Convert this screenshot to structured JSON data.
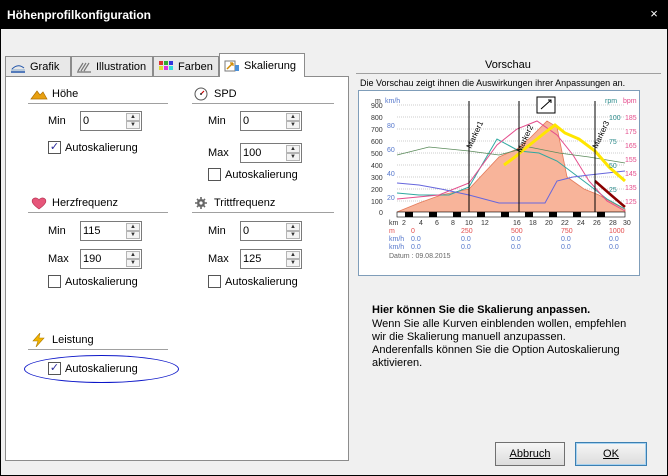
{
  "window": {
    "title": "Höhenprofilkonfiguration",
    "close_glyph": "×"
  },
  "tabs": [
    {
      "label": "Grafik",
      "icon": "grafik-icon"
    },
    {
      "label": "Illustration",
      "icon": "illustration-icon"
    },
    {
      "label": "Farben",
      "icon": "farben-icon"
    },
    {
      "label": "Skalierung",
      "icon": "skalierung-icon",
      "active": true
    }
  ],
  "groups": {
    "hoehe": {
      "title": "Höhe",
      "min_label": "Min",
      "min_value": "0",
      "autoscale_label": "Autoskalierung",
      "autoscale_checked": true
    },
    "spd": {
      "title": "SPD",
      "min_label": "Min",
      "min_value": "0",
      "max_label": "Max",
      "max_value": "100",
      "autoscale_label": "Autoskalierung",
      "autoscale_checked": false
    },
    "herzfrequenz": {
      "title": "Herzfrequenz",
      "min_label": "Min",
      "min_value": "115",
      "max_label": "Max",
      "max_value": "190",
      "autoscale_label": "Autoskalierung",
      "autoscale_checked": false
    },
    "trittfrequenz": {
      "title": "Trittfrequenz",
      "min_label": "Min",
      "min_value": "0",
      "max_label": "Max",
      "max_value": "125",
      "autoscale_label": "Autoskalierung",
      "autoscale_checked": false
    },
    "leistung": {
      "title": "Leistung",
      "autoscale_label": "Autoskalierung",
      "autoscale_checked": true
    }
  },
  "check_glyph": "✓",
  "preview": {
    "title": "Vorschau",
    "description": "Die Vorschau zeigt ihnen die Auswirkungen ihrer Anpassungen an.",
    "chart": {
      "left_units": [
        "m",
        "km/h"
      ],
      "right_units": [
        "rpm",
        "bpm"
      ],
      "y_left": [
        "900",
        "800",
        "700",
        "600",
        "500",
        "400",
        "300",
        "200",
        "100",
        "0"
      ],
      "y_spd": [
        "80",
        "60",
        "40",
        "20"
      ],
      "y_rpm": [
        "100",
        "75",
        "50",
        "25"
      ],
      "y_bpm": [
        "185",
        "175",
        "165",
        "155",
        "145",
        "135",
        "125"
      ],
      "markers": [
        "Marker1",
        "Marker2",
        "Marker3"
      ],
      "km_label": "km",
      "km_ticks": [
        "2",
        "4",
        "6",
        "8",
        "10",
        "12",
        "16",
        "18",
        "20",
        "22",
        "24",
        "26",
        "28",
        "30"
      ],
      "row_m_label": "m",
      "row_m_values": [
        "0",
        "250",
        "500",
        "750",
        "1000"
      ],
      "row_kmh_label": "km/h",
      "row_kmh_values": [
        "0.0",
        "0.0",
        "0.0",
        "0.0",
        "0.0"
      ],
      "row_kmh2_label": "km/h",
      "row_kmh2_values": [
        "0.0",
        "0.0",
        "0.0",
        "0.0",
        "0.0"
      ],
      "datum": "Datum : 09.08.2015"
    }
  },
  "help": {
    "heading": "Hier können Sie die Skalierung anpassen.",
    "body": "Wenn Sie alle Kurven einblenden wollen, empfehlen\nwir die Skalierung manuell anzupassen.\nAnderenfalls können Sie die Option Autoskalierung\naktivieren."
  },
  "buttons": {
    "cancel": "Abbruch",
    "ok": "OK"
  },
  "spin_up": "▲",
  "spin_down": "▼"
}
